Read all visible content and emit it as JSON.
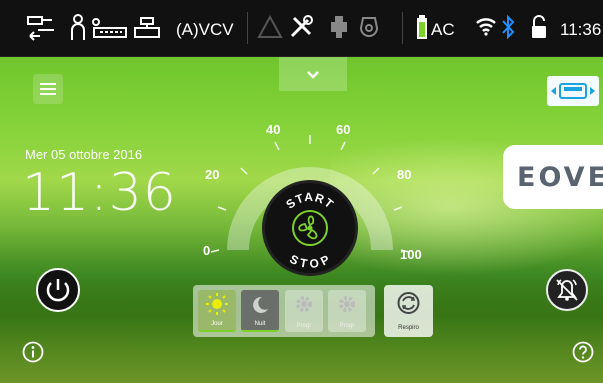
{
  "status_bar": {
    "mode": "(A)VCV",
    "power_source": "AC",
    "clock": "11:36",
    "icons": [
      "patient-circuit-icon",
      "patient-icon",
      "circuit-valve-icon",
      "filter-icon",
      "alarm-triangle-icon",
      "tools-icon",
      "accessory-icon",
      "mask-icon",
      "battery-icon",
      "wifi-icon",
      "bluetooth-icon",
      "lock-icon"
    ],
    "battery_color": "#7cd12a",
    "bluetooth_color": "#1e90ff"
  },
  "main": {
    "date": "Mer 05 ottobre 2016",
    "time": "11:36",
    "logo": "EOVE"
  },
  "gauge": {
    "labels": [
      "0",
      "20",
      "40",
      "60",
      "80",
      "100"
    ],
    "start_label": "START",
    "stop_label": "STOP"
  },
  "modes": [
    {
      "label": "Jour",
      "icon": "sun-icon",
      "active": true
    },
    {
      "label": "Nuit",
      "icon": "moon-icon",
      "active": false
    },
    {
      "label": "Progr",
      "icon": "gear-icon",
      "active": false
    },
    {
      "label": "Progr",
      "icon": "gear-icon",
      "active": false
    }
  ],
  "respiro": {
    "label": "Respiro",
    "icon": "respiro-icon"
  },
  "colors": {
    "accent_green": "#7cd12a",
    "active_mode_bg": "#9ab86a",
    "mode_bg": "#6a6f6a"
  }
}
